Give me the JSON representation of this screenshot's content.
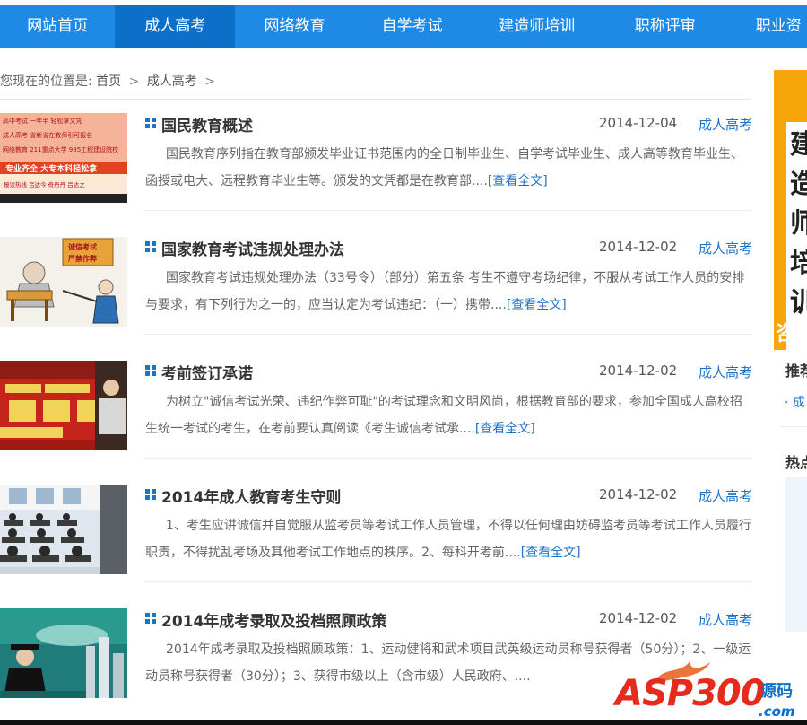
{
  "nav": {
    "items": [
      {
        "label": "网站首页"
      },
      {
        "label": "成人高考"
      },
      {
        "label": "网络教育"
      },
      {
        "label": "自学考试"
      },
      {
        "label": "建造师培训"
      },
      {
        "label": "职称评审"
      },
      {
        "label": "职业资"
      }
    ],
    "active_index": 1
  },
  "breadcrumb": {
    "prefix": "您现在的位置是:",
    "home": "首页",
    "current": "成人高考",
    "separator": ">"
  },
  "articles": [
    {
      "title": "国民教育概述",
      "date": "2014-12-04",
      "category": "成人高考",
      "summary": "国民教育序列指在教育部颁发毕业证书范围内的全日制毕业生、自学考试毕业生、成人高等教育毕业生、函授或电大、远程教育毕业生等。颁发的文凭都是在教育部....",
      "read_more": "[查看全文]"
    },
    {
      "title": "国家教育考试违规处理办法",
      "date": "2014-12-02",
      "category": "成人高考",
      "summary": "国家教育考试违规处理办法（33号令）（部分）第五条 考生不遵守考场纪律，不服从考试工作人员的安排与要求，有下列行为之一的，应当认定为考试违纪：（一）携带....",
      "read_more": "[查看全文]"
    },
    {
      "title": "考前签订承诺",
      "date": "2014-12-02",
      "category": "成人高考",
      "summary": "为树立\"诚信考试光荣、违纪作弊可耻\"的考试理念和文明风尚，根据教育部的要求，参加全国成人高校招生统一考试的考生，在考前要认真阅读《考生诚信考试承....",
      "read_more": "[查看全文]"
    },
    {
      "title": "2014年成人教育考生守则",
      "date": "2014-12-02",
      "category": "成人高考",
      "summary": "1、考生应讲诚信并自觉服从监考员等考试工作人员管理，不得以任何理由妨碍监考员等考试工作人员履行职责，不得扰乱考场及其他考试工作地点的秩序。2、每科开考前....",
      "read_more": "[查看全文]"
    },
    {
      "title": "2014年成考录取及投档照顾政策",
      "date": "2014-12-02",
      "category": "成人高考",
      "summary": "2014年成考录取及投档照顾政策：1、运动健将和武术项目武英级运动员称号获得者（50分）；2、一级运动员称号获得者（30分）；3、获得市级以上（含市级）人民政府、....",
      "read_more": ""
    }
  ],
  "thumbnails": [
    {
      "lines": [
        "高中考试 一年半 轻松拿文凭",
        "成人高考 省新省在教师引可报名",
        "网络教育 211重点大学 985工程建设院校",
        "专业齐全 大专本科轻松拿",
        "报读热线 吕达今 奇丹丹 吕达之"
      ]
    },
    {
      "lines": [
        "诚信考试",
        "严禁作弊"
      ]
    },
    {
      "lines": []
    },
    {
      "lines": []
    },
    {
      "lines": []
    }
  ],
  "sidebar": {
    "ad_text": "建造师培训",
    "ad_consult": "咨询",
    "recommend_title": "推荐",
    "recommend_item": "· 成",
    "hot_title": "热点"
  },
  "watermark": {
    "logo": "ASP300",
    "cn": "源码",
    "com": ".com"
  },
  "colors": {
    "nav_bg": "#1e8ae6",
    "nav_active": "#0d6fc8",
    "link_blue": "#1e73c8",
    "ad_orange": "#f6a60a"
  }
}
